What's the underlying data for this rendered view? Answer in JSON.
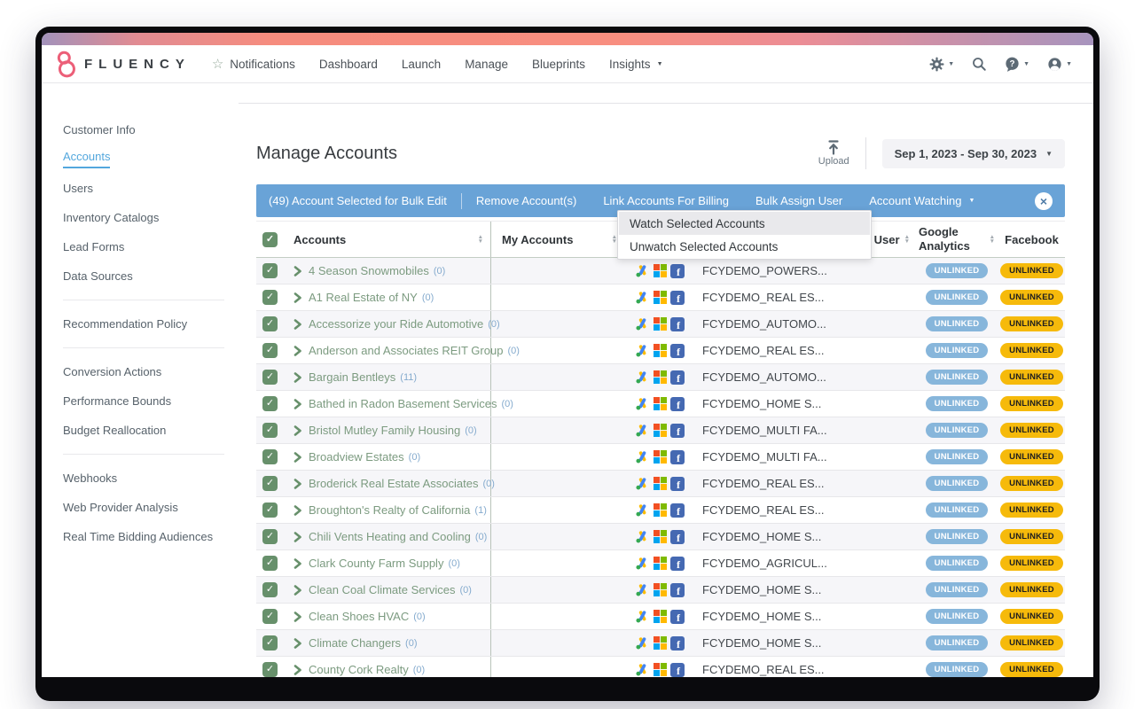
{
  "topnav": {
    "brand": "FLUENCY",
    "items": [
      {
        "label": "Notifications",
        "star": true
      },
      {
        "label": "Dashboard"
      },
      {
        "label": "Launch"
      },
      {
        "label": "Manage"
      },
      {
        "label": "Blueprints"
      },
      {
        "label": "Insights",
        "caret": true
      }
    ],
    "right_icons": [
      "gear-icon",
      "search-icon",
      "help-icon",
      "user-icon"
    ]
  },
  "sidebar": {
    "items": [
      {
        "label": "Customer Info"
      },
      {
        "label": "Accounts",
        "active": true
      },
      {
        "label": "Users"
      },
      {
        "label": "Inventory Catalogs"
      },
      {
        "label": "Lead Forms"
      },
      {
        "label": "Data Sources",
        "divider_after": true
      },
      {
        "label": "Recommendation Policy",
        "divider_after": true
      },
      {
        "label": "Conversion Actions"
      },
      {
        "label": "Performance Bounds"
      },
      {
        "label": "Budget Reallocation",
        "divider_after": true
      },
      {
        "label": "Webhooks"
      },
      {
        "label": "Web Provider Analysis"
      },
      {
        "label": "Real Time Bidding Audiences"
      }
    ]
  },
  "header": {
    "title": "Manage Accounts",
    "upload_label": "Upload",
    "date_range": "Sep 1, 2023 - Sep 30, 2023"
  },
  "bulk_toolbar": {
    "selection_label": "(49) Account Selected for Bulk Edit",
    "actions": [
      {
        "label": "Remove Account(s)"
      },
      {
        "label": "Link Accounts For Billing"
      },
      {
        "label": "Bulk Assign User"
      }
    ],
    "watch_label": "Account Watching",
    "close_glyph": "×"
  },
  "watch_dropdown": {
    "items": [
      {
        "label": "Watch Selected Accounts",
        "highlighted": true
      },
      {
        "label": "Unwatch Selected Accounts"
      }
    ]
  },
  "table": {
    "columns": {
      "accounts": "Accounts",
      "my_accounts": "My Accounts",
      "user": "User",
      "google_analytics": "Google Analytics",
      "facebook": "Facebook"
    },
    "platform_icons": [
      "google-ads-icon",
      "microsoft-ads-icon",
      "facebook-icon"
    ],
    "rows": [
      {
        "name": "4 Season Snowmobiles",
        "count": "(0)",
        "account_id": "FCYDEMO_POWERS...",
        "ga_status": "UNLINKED",
        "fb_status": "UNLINKED"
      },
      {
        "name": "A1 Real Estate of NY",
        "count": "(0)",
        "account_id": "FCYDEMO_REAL ES...",
        "ga_status": "UNLINKED",
        "fb_status": "UNLINKED"
      },
      {
        "name": "Accessorize your Ride Automotive",
        "count": "(0)",
        "account_id": "FCYDEMO_AUTOMO...",
        "ga_status": "UNLINKED",
        "fb_status": "UNLINKED"
      },
      {
        "name": "Anderson and Associates REIT Group",
        "count": "(0)",
        "account_id": "FCYDEMO_REAL ES...",
        "ga_status": "UNLINKED",
        "fb_status": "UNLINKED"
      },
      {
        "name": "Bargain Bentleys",
        "count": "(11)",
        "account_id": "FCYDEMO_AUTOMO...",
        "ga_status": "UNLINKED",
        "fb_status": "UNLINKED"
      },
      {
        "name": "Bathed in Radon Basement Services",
        "count": "(0)",
        "account_id": "FCYDEMO_HOME S...",
        "ga_status": "UNLINKED",
        "fb_status": "UNLINKED"
      },
      {
        "name": "Bristol Mutley Family Housing",
        "count": "(0)",
        "account_id": "FCYDEMO_MULTI FA...",
        "ga_status": "UNLINKED",
        "fb_status": "UNLINKED"
      },
      {
        "name": "Broadview Estates",
        "count": "(0)",
        "account_id": "FCYDEMO_MULTI FA...",
        "ga_status": "UNLINKED",
        "fb_status": "UNLINKED"
      },
      {
        "name": "Broderick Real Estate Associates",
        "count": "(0)",
        "account_id": "FCYDEMO_REAL ES...",
        "ga_status": "UNLINKED",
        "fb_status": "UNLINKED"
      },
      {
        "name": "Broughton's Realty of California",
        "count": "(1)",
        "account_id": "FCYDEMO_REAL ES...",
        "ga_status": "UNLINKED",
        "fb_status": "UNLINKED"
      },
      {
        "name": "Chili Vents Heating and Cooling",
        "count": "(0)",
        "account_id": "FCYDEMO_HOME S...",
        "ga_status": "UNLINKED",
        "fb_status": "UNLINKED"
      },
      {
        "name": "Clark County Farm Supply",
        "count": "(0)",
        "account_id": "FCYDEMO_AGRICUL...",
        "ga_status": "UNLINKED",
        "fb_status": "UNLINKED"
      },
      {
        "name": "Clean Coal Climate Services",
        "count": "(0)",
        "account_id": "FCYDEMO_HOME S...",
        "ga_status": "UNLINKED",
        "fb_status": "UNLINKED"
      },
      {
        "name": "Clean Shoes HVAC",
        "count": "(0)",
        "account_id": "FCYDEMO_HOME S...",
        "ga_status": "UNLINKED",
        "fb_status": "UNLINKED"
      },
      {
        "name": "Climate Changers",
        "count": "(0)",
        "account_id": "FCYDEMO_HOME S...",
        "ga_status": "UNLINKED",
        "fb_status": "UNLINKED"
      },
      {
        "name": "County Cork Realty",
        "count": "(0)",
        "account_id": "FCYDEMO_REAL ES...",
        "ga_status": "UNLINKED",
        "fb_status": "UNLINKED"
      }
    ]
  },
  "colors": {
    "toolbar_blue": "#69a3d7",
    "badge_blue": "#87b6db",
    "badge_yellow": "#f6ba0b",
    "row_green": "#7c9b80",
    "checkbox_green": "#67906b",
    "active_blue": "#53a7dd"
  }
}
